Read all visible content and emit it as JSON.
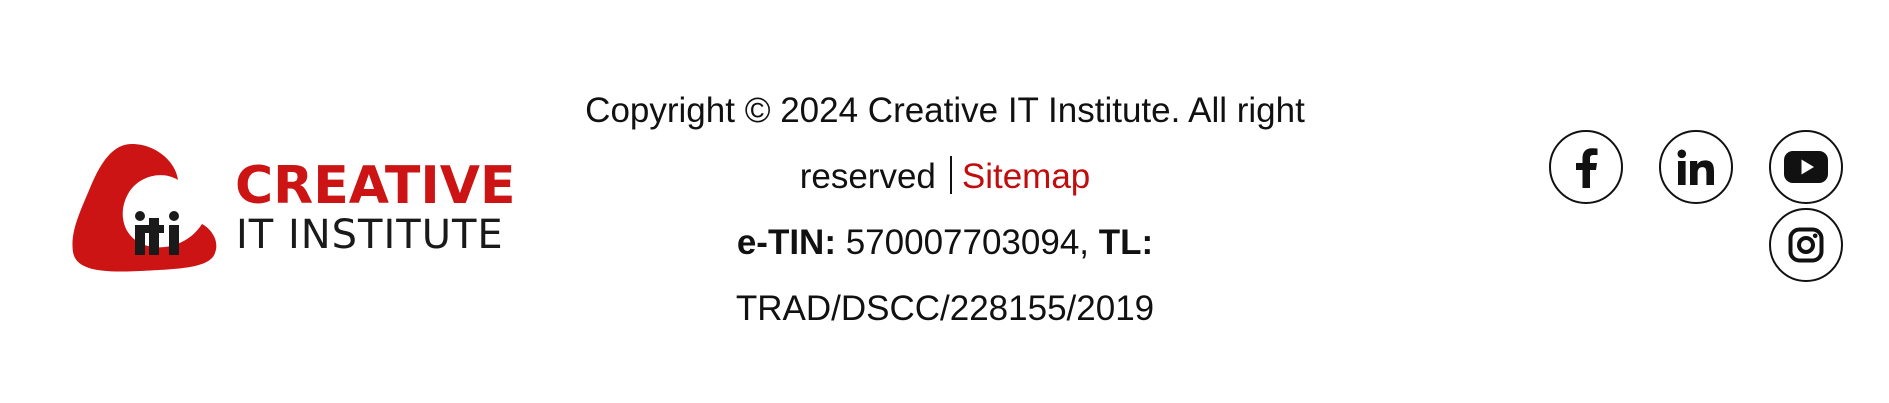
{
  "logo": {
    "line1": "CREATIVE",
    "line2": "IT INSTITUTE",
    "mark_text": "iti",
    "brand_color": "#cc1414"
  },
  "copyright": {
    "line1": "Copyright © 2024 Creative IT Institute. All right",
    "reserved": "reserved",
    "sitemap_label": "Sitemap",
    "etin_label": "e-TIN:",
    "etin_value": " 570007703094,",
    "tl_label": " TL:",
    "tl_value": "TRAD/DSCC/228155/2019",
    "link_color": "#c00d0d"
  },
  "social": {
    "facebook": "facebook-icon",
    "linkedin": "linkedin-icon",
    "youtube": "youtube-icon",
    "instagram": "instagram-icon"
  }
}
